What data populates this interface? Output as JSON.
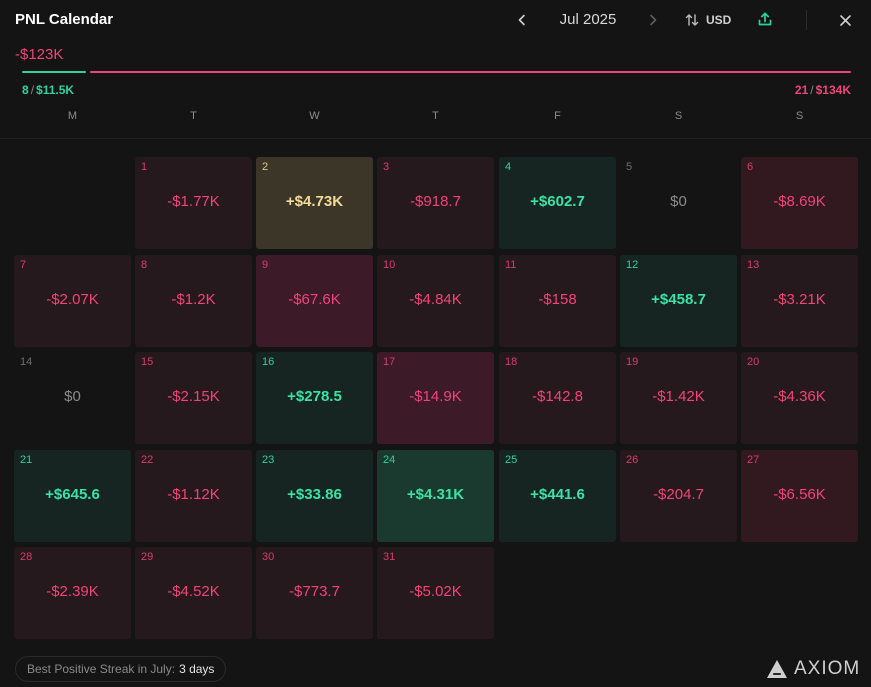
{
  "header": {
    "title": "PNL Calendar",
    "month": "Jul 2025",
    "currency": "USD"
  },
  "summary": {
    "total": "-$123K",
    "positive_days": "8",
    "positive_total": "$11.5K",
    "negative_days": "21",
    "negative_total": "$134K",
    "separator": "/"
  },
  "weekdays": [
    "M",
    "T",
    "W",
    "T",
    "F",
    "S",
    "S"
  ],
  "days": [
    {
      "day": "1",
      "value": "-$1.77K",
      "kind": "neg",
      "tint": 1
    },
    {
      "day": "2",
      "value": "+$4.73K",
      "kind": "best",
      "tint": 1
    },
    {
      "day": "3",
      "value": "-$918.7",
      "kind": "neg",
      "tint": 1
    },
    {
      "day": "4",
      "value": "+$602.7",
      "kind": "pos",
      "tint": 1
    },
    {
      "day": "5",
      "value": "$0",
      "kind": "zero",
      "tint": 0
    },
    {
      "day": "6",
      "value": "-$8.69K",
      "kind": "neg",
      "tint": 2
    },
    {
      "day": "7",
      "value": "-$2.07K",
      "kind": "neg",
      "tint": 1
    },
    {
      "day": "8",
      "value": "-$1.2K",
      "kind": "neg",
      "tint": 1
    },
    {
      "day": "9",
      "value": "-$67.6K",
      "kind": "neg",
      "tint": 3
    },
    {
      "day": "10",
      "value": "-$4.84K",
      "kind": "neg",
      "tint": 1
    },
    {
      "day": "11",
      "value": "-$158",
      "kind": "neg",
      "tint": 1
    },
    {
      "day": "12",
      "value": "+$458.7",
      "kind": "pos",
      "tint": 1
    },
    {
      "day": "13",
      "value": "-$3.21K",
      "kind": "neg",
      "tint": 1
    },
    {
      "day": "14",
      "value": "$0",
      "kind": "zero",
      "tint": 0
    },
    {
      "day": "15",
      "value": "-$2.15K",
      "kind": "neg",
      "tint": 1
    },
    {
      "day": "16",
      "value": "+$278.5",
      "kind": "pos",
      "tint": 1
    },
    {
      "day": "17",
      "value": "-$14.9K",
      "kind": "neg",
      "tint": 3
    },
    {
      "day": "18",
      "value": "-$142.8",
      "kind": "neg",
      "tint": 1
    },
    {
      "day": "19",
      "value": "-$1.42K",
      "kind": "neg",
      "tint": 1
    },
    {
      "day": "20",
      "value": "-$4.36K",
      "kind": "neg",
      "tint": 1
    },
    {
      "day": "21",
      "value": "+$645.6",
      "kind": "pos",
      "tint": 1
    },
    {
      "day": "22",
      "value": "-$1.12K",
      "kind": "neg",
      "tint": 1
    },
    {
      "day": "23",
      "value": "+$33.86",
      "kind": "pos",
      "tint": 1
    },
    {
      "day": "24",
      "value": "+$4.31K",
      "kind": "pos",
      "tint": 2
    },
    {
      "day": "25",
      "value": "+$441.6",
      "kind": "pos",
      "tint": 1
    },
    {
      "day": "26",
      "value": "-$204.7",
      "kind": "neg",
      "tint": 1
    },
    {
      "day": "27",
      "value": "-$6.56K",
      "kind": "neg",
      "tint": 2
    },
    {
      "day": "28",
      "value": "-$2.39K",
      "kind": "neg",
      "tint": 1
    },
    {
      "day": "29",
      "value": "-$4.52K",
      "kind": "neg",
      "tint": 1
    },
    {
      "day": "30",
      "value": "-$773.7",
      "kind": "neg",
      "tint": 1
    },
    {
      "day": "31",
      "value": "-$5.02K",
      "kind": "neg",
      "tint": 1
    }
  ],
  "footer": {
    "streak_label": "Best Positive Streak in July:",
    "streak_value": "3 days",
    "brand": "AXIOM"
  },
  "icons": {
    "prev": "chevron-left-icon",
    "next": "chevron-right-icon",
    "currency": "swap-vertical-icon",
    "share": "upload-icon",
    "close": "close-icon",
    "logo": "triangle-logo-icon"
  },
  "colors": {
    "positive": "#2fd39a",
    "negative": "#f2437a",
    "best_day": "#f2dc97",
    "background": "#141414"
  }
}
